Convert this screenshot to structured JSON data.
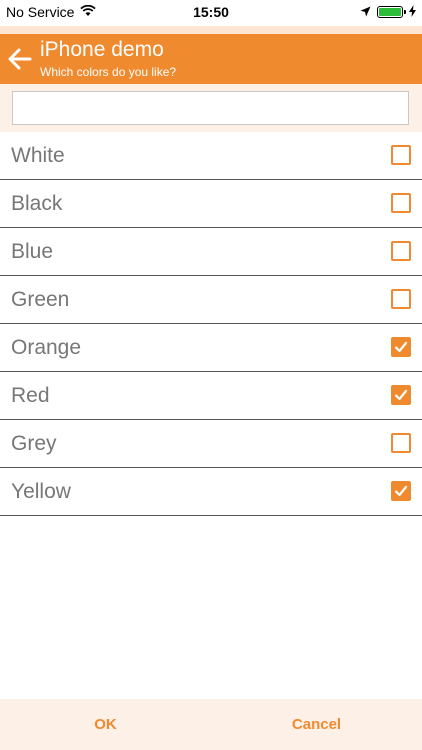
{
  "status_bar": {
    "carrier": "No Service",
    "time": "15:50"
  },
  "header": {
    "title": "iPhone demo",
    "subtitle": "Which colors do you like?"
  },
  "search": {
    "value": "",
    "placeholder": ""
  },
  "colors": [
    {
      "label": "White",
      "checked": false
    },
    {
      "label": "Black",
      "checked": false
    },
    {
      "label": "Blue",
      "checked": false
    },
    {
      "label": "Green",
      "checked": false
    },
    {
      "label": "Orange",
      "checked": true
    },
    {
      "label": "Red",
      "checked": true
    },
    {
      "label": "Grey",
      "checked": false
    },
    {
      "label": "Yellow",
      "checked": true
    }
  ],
  "footer": {
    "ok_label": "OK",
    "cancel_label": "Cancel"
  },
  "theme": {
    "accent": "#f08a2f",
    "accent_light": "#fdf0e6"
  }
}
